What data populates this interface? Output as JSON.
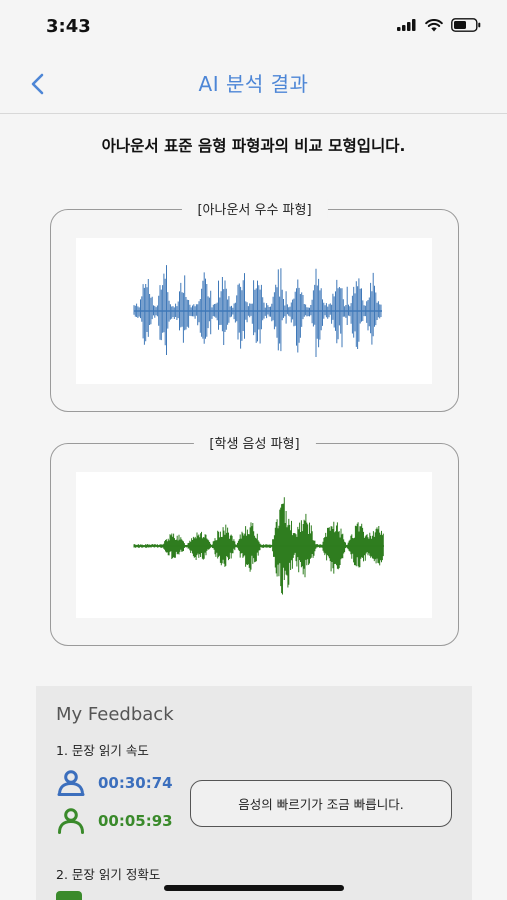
{
  "status": {
    "time": "3:43"
  },
  "nav": {
    "title": "AI 분석 결과",
    "back_icon": "chevron-left-icon"
  },
  "intro": "아나운서 표준 음형 파형과의 비교 모형입니다.",
  "cards": {
    "announcer": {
      "label": "[아나운서 우수 파형]",
      "color": "#3f78b8"
    },
    "student": {
      "label": "[학생 음성 파형]",
      "color": "#2f7d1f"
    }
  },
  "feedback": {
    "title": "My Feedback",
    "section1": "1. 문장 읽기 속도",
    "announcer_time": "00:30:74",
    "student_time": "00:05:93",
    "message": "음성의 빠르기가 조금 빠릅니다.",
    "section2": "2. 문장 읽기 정확도",
    "colors": {
      "blue": "#3c6fbd",
      "green": "#3a8a2b"
    }
  }
}
